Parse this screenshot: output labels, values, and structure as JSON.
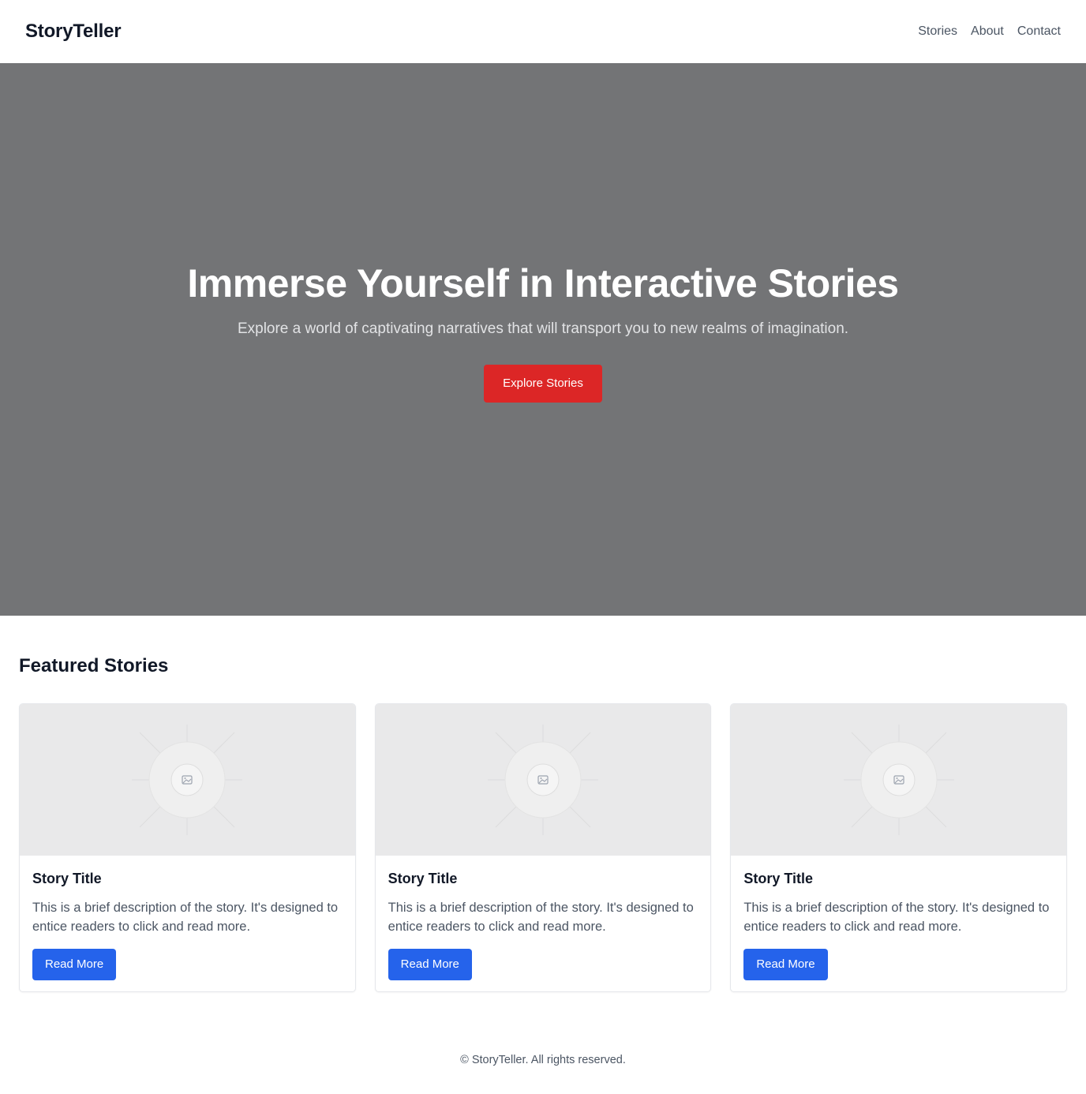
{
  "header": {
    "logo": "StoryTeller",
    "nav": [
      "Stories",
      "About",
      "Contact"
    ]
  },
  "hero": {
    "title": "Immerse Yourself in Interactive Stories",
    "subtitle": "Explore a world of captivating narratives that will transport you to new realms of imagination.",
    "cta_label": "Explore Stories",
    "background_color": "#737476",
    "cta_color": "#dc2626"
  },
  "featured": {
    "heading": "Featured Stories",
    "cards": [
      {
        "image_icon": "image-placeholder-icon",
        "title": "Story Title",
        "description": "This is a brief description of the story. It's designed to entice readers to click and read more.",
        "button_label": "Read More"
      },
      {
        "image_icon": "image-placeholder-icon",
        "title": "Story Title",
        "description": "This is a brief description of the story. It's designed to entice readers to click and read more.",
        "button_label": "Read More"
      },
      {
        "image_icon": "image-placeholder-icon",
        "title": "Story Title",
        "description": "This is a brief description of the story. It's designed to entice readers to click and read more.",
        "button_label": "Read More"
      }
    ],
    "button_color": "#2563eb"
  },
  "footer": {
    "text": "© StoryTeller. All rights reserved."
  }
}
